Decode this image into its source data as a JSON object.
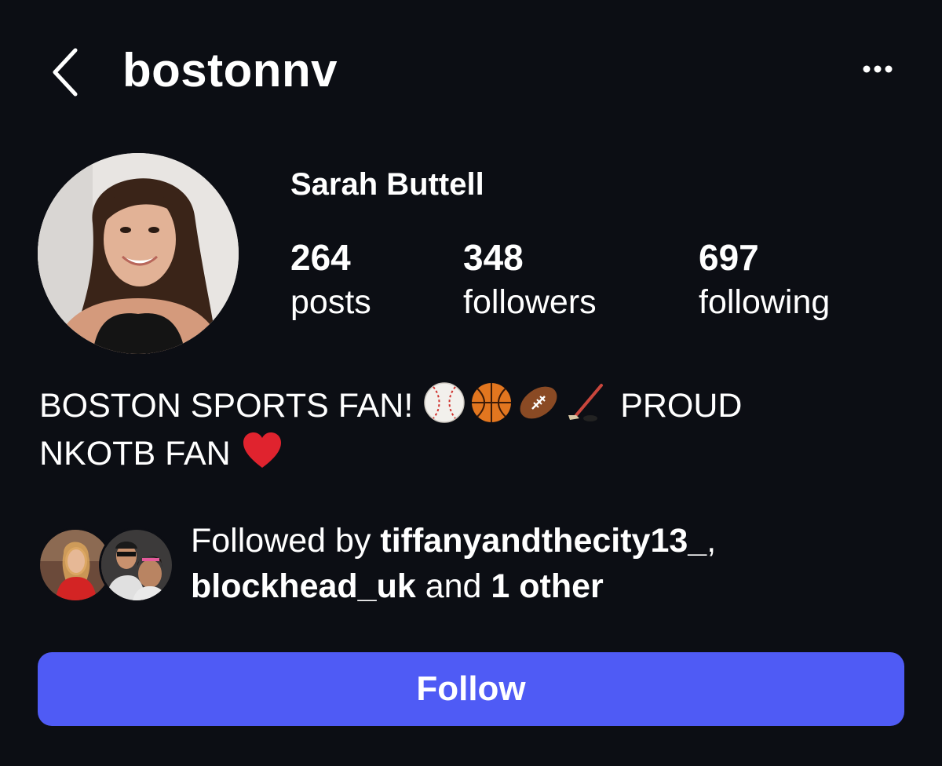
{
  "header": {
    "username": "bostonnv",
    "back_icon": "chevron-left-icon",
    "more_icon": "more-horizontal-icon"
  },
  "profile": {
    "display_name": "Sarah Buttell",
    "stats": [
      {
        "value": "264",
        "label": "posts"
      },
      {
        "value": "348",
        "label": "followers"
      },
      {
        "value": "697",
        "label": "following"
      }
    ]
  },
  "bio": {
    "line1_text": "BOSTON SPORTS FAN!",
    "emojis": [
      "baseball-emoji",
      "basketball-emoji",
      "football-emoji",
      "hockey-stick-emoji",
      "red-heart-emoji"
    ],
    "line1_end": "PROUD",
    "line2_text": "NKOTB FAN"
  },
  "followed_by": {
    "prefix": "Followed by",
    "user1": "tiffanyandthecity13_",
    "separator": ",",
    "user2": "blockhead_uk",
    "conjunction": "and",
    "others": "1 other"
  },
  "follow_button": {
    "label": "Follow",
    "color": "#4f5bf5"
  },
  "colors": {
    "background": "#0c0e14",
    "text": "#ffffff",
    "accent": "#4f5bf5"
  }
}
